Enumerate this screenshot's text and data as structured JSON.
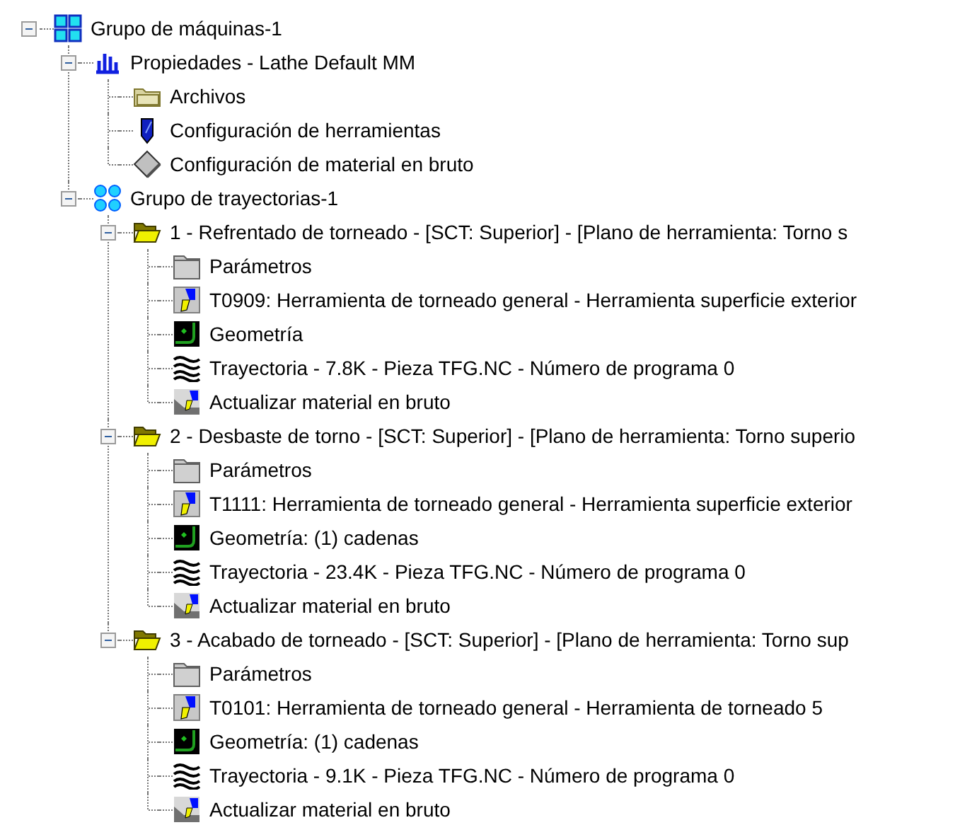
{
  "tree": [
    {
      "kind": "machine-group",
      "label": "Grupo de máquinas-1",
      "expanded": true,
      "children": [
        {
          "kind": "properties",
          "label": "Propiedades - Lathe Default MM",
          "expanded": true,
          "children": [
            {
              "kind": "files",
              "label": "Archivos"
            },
            {
              "kind": "tool-settings",
              "label": "Configuración de herramientas"
            },
            {
              "kind": "stock-setup",
              "label": "Configuración de material en bruto"
            }
          ]
        },
        {
          "kind": "toolpath-group",
          "label": "Grupo de trayectorias-1",
          "expanded": true,
          "children": [
            {
              "kind": "operation",
              "label": "1 - Refrentado de torneado - [SCT: Superior] - [Plano de herramienta: Torno s",
              "expanded": true,
              "children": [
                {
                  "kind": "parameters",
                  "label": "Parámetros"
                },
                {
                  "kind": "tool",
                  "label": "T0909: Herramienta de torneado general - Herramienta superficie exterior"
                },
                {
                  "kind": "geometry",
                  "label": "Geometría"
                },
                {
                  "kind": "toolpath",
                  "label": "Trayectoria - 7.8K - Pieza TFG.NC - Número de programa 0"
                },
                {
                  "kind": "update-stock",
                  "label": "Actualizar material en bruto"
                }
              ]
            },
            {
              "kind": "operation",
              "label": "2 - Desbaste de torno - [SCT: Superior] - [Plano de herramienta: Torno superio",
              "expanded": true,
              "children": [
                {
                  "kind": "parameters",
                  "label": "Parámetros"
                },
                {
                  "kind": "tool",
                  "label": "T1111: Herramienta de torneado general - Herramienta superficie exterior"
                },
                {
                  "kind": "geometry",
                  "label": "Geometría: (1) cadenas"
                },
                {
                  "kind": "toolpath",
                  "label": "Trayectoria - 23.4K - Pieza TFG.NC - Número de programa 0"
                },
                {
                  "kind": "update-stock",
                  "label": "Actualizar material en bruto"
                }
              ]
            },
            {
              "kind": "operation",
              "label": "3 - Acabado de torneado - [SCT: Superior] - [Plano de herramienta: Torno sup",
              "expanded": true,
              "children": [
                {
                  "kind": "parameters",
                  "label": "Parámetros"
                },
                {
                  "kind": "tool",
                  "label": "T0101: Herramienta de torneado general - Herramienta de torneado 5"
                },
                {
                  "kind": "geometry",
                  "label": "Geometría: (1) cadenas"
                },
                {
                  "kind": "toolpath",
                  "label": "Trayectoria - 9.1K - Pieza TFG.NC - Número de programa 0"
                },
                {
                  "kind": "update-stock",
                  "label": "Actualizar material en bruto"
                }
              ]
            }
          ]
        }
      ]
    }
  ]
}
